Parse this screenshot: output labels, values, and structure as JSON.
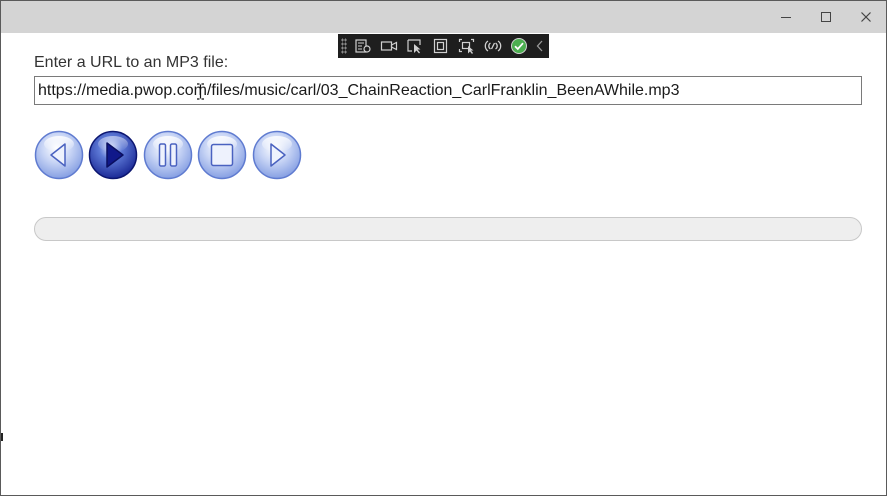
{
  "window": {
    "caption_buttons": [
      "minimize-icon",
      "maximize-icon",
      "close-icon"
    ]
  },
  "debug_toolbar": {
    "buttons": [
      "live-visual-tree-icon",
      "video-icon",
      "select-element-icon",
      "display-adorners-icon",
      "track-focus-icon",
      "hot-reload-icon",
      "check-circle-icon",
      "collapse-chevron-icon"
    ],
    "accent_color": "#4caf50"
  },
  "form": {
    "url_label": "Enter a URL to an MP3 file:",
    "url_value": "https://media.pwop.com/files/music/carl/03_ChainReaction_CarlFranklin_BeenAWhile.mp3"
  },
  "player": {
    "buttons": [
      "previous-icon",
      "play-icon",
      "pause-icon",
      "stop-icon",
      "next-icon"
    ],
    "active_button": "play-icon",
    "progress": 0
  },
  "colors": {
    "titlebar": "#d4d4d4",
    "button_blue": "#8ea8e8",
    "button_blue_active": "#1a2a9a",
    "track": "#eeeeee"
  }
}
